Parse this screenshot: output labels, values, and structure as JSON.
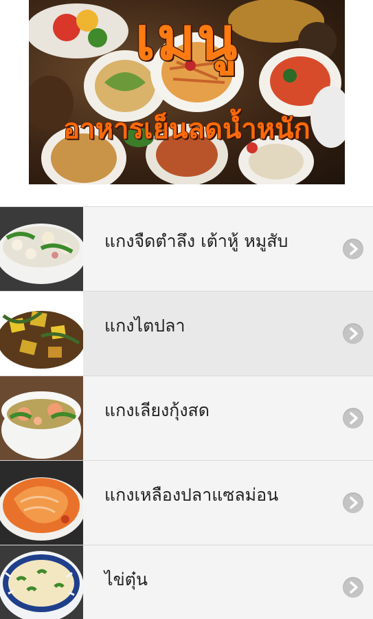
{
  "banner": {
    "title": "เมนู",
    "subtitle": "อาหารเย็นลดน้ำหนัก"
  },
  "menu": {
    "items": [
      {
        "label": "แกงจืดตำลึง เต้าหู้ หมูสับ",
        "thumb": "clear-soup-tofu-pork-photo"
      },
      {
        "label": "แกงไตปลา",
        "thumb": "fish-kidney-curry-photo"
      },
      {
        "label": "แกงเลียงกุ้งสด",
        "thumb": "spicy-vegetable-shrimp-soup-photo"
      },
      {
        "label": "แกงเหลืองปลาแซลม่อน",
        "thumb": "yellow-curry-salmon-photo"
      },
      {
        "label": "ไข่ตุ๋น",
        "thumb": "steamed-egg-photo"
      }
    ],
    "chevron_icon": "chevron-right-icon"
  },
  "colors": {
    "title_orange": "#ff7b12",
    "list_bg": "#f4f4f4",
    "list_bg_active": "#e9e9e9",
    "chevron_bg": "#c4c4c4"
  }
}
